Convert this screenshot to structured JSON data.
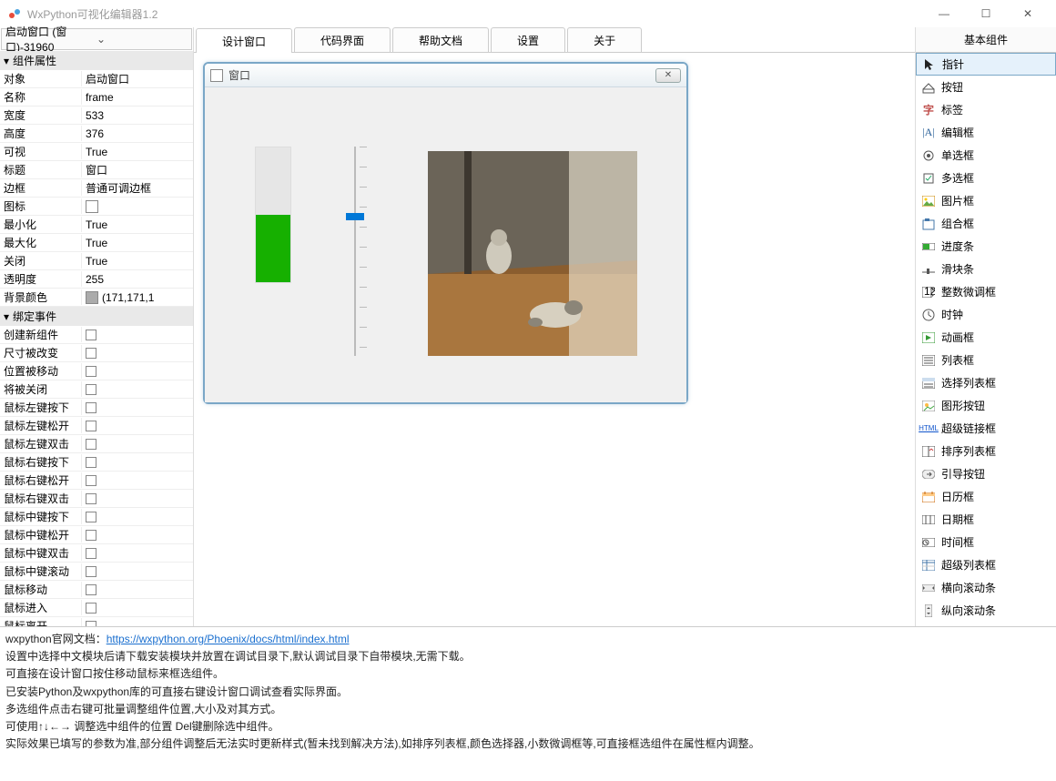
{
  "app": {
    "title": "WxPython可视化编辑器1.2"
  },
  "window_controls": {
    "min": "—",
    "max": "☐",
    "close": "✕"
  },
  "left": {
    "combo": "启动窗口  (窗口)-31960",
    "section_props": "组件属性",
    "section_events": "绑定事件",
    "props": [
      {
        "k": "对象",
        "v": "启动窗口"
      },
      {
        "k": "名称",
        "v": "frame"
      },
      {
        "k": "宽度",
        "v": "533"
      },
      {
        "k": "高度",
        "v": "376"
      },
      {
        "k": "可视",
        "v": "True"
      },
      {
        "k": "标题",
        "v": "窗口"
      },
      {
        "k": "边框",
        "v": "普通可调边框"
      },
      {
        "k": "图标",
        "v": "",
        "swatch": "#ffffff"
      },
      {
        "k": "最小化",
        "v": "True"
      },
      {
        "k": "最大化",
        "v": "True"
      },
      {
        "k": "关闭",
        "v": "True"
      },
      {
        "k": "透明度",
        "v": "255"
      },
      {
        "k": "背景颜色",
        "v": "(171,171,1",
        "swatch": "#ababab"
      }
    ],
    "events": [
      "创建新组件",
      "尺寸被改变",
      "位置被移动",
      "将被关闭",
      "鼠标左键按下",
      "鼠标左键松开",
      "鼠标左键双击",
      "鼠标右键按下",
      "鼠标右键松开",
      "鼠标右键双击",
      "鼠标中键按下",
      "鼠标中键松开",
      "鼠标中键双击",
      "鼠标中键滚动",
      "鼠标移动",
      "鼠标进入",
      "鼠标离开"
    ]
  },
  "tabs": [
    "设计窗口",
    "代码界面",
    "帮助文档",
    "设置",
    "关于"
  ],
  "sim": {
    "title": "窗口",
    "close": "✕"
  },
  "right": {
    "header": "基本组件",
    "items": [
      {
        "icon": "cursor",
        "label": "指针"
      },
      {
        "icon": "btn",
        "label": "按钮"
      },
      {
        "icon": "label",
        "label": "标签"
      },
      {
        "icon": "edit",
        "label": "编辑框"
      },
      {
        "icon": "radio",
        "label": "单选框"
      },
      {
        "icon": "check",
        "label": "多选框"
      },
      {
        "icon": "image",
        "label": "图片框"
      },
      {
        "icon": "group",
        "label": "组合框"
      },
      {
        "icon": "progress",
        "label": "进度条"
      },
      {
        "icon": "slider",
        "label": "滑块条"
      },
      {
        "icon": "spin",
        "label": "整数微调框"
      },
      {
        "icon": "clock",
        "label": "时钟"
      },
      {
        "icon": "anim",
        "label": "动画框"
      },
      {
        "icon": "list",
        "label": "列表框"
      },
      {
        "icon": "choice",
        "label": "选择列表框"
      },
      {
        "icon": "bmpbtn",
        "label": "图形按钮"
      },
      {
        "icon": "link",
        "label": "超级链接框"
      },
      {
        "icon": "sortlist",
        "label": "排序列表框"
      },
      {
        "icon": "wizard",
        "label": "引导按钮"
      },
      {
        "icon": "cal",
        "label": "日历框"
      },
      {
        "icon": "date",
        "label": "日期框"
      },
      {
        "icon": "time",
        "label": "时间框"
      },
      {
        "icon": "superlist",
        "label": "超级列表框"
      },
      {
        "icon": "hscroll",
        "label": "横向滚动条"
      },
      {
        "icon": "vscroll",
        "label": "纵向滚动条"
      }
    ]
  },
  "bottom": {
    "l1a": "wxpython官网文档：",
    "l1link": "https://wxpython.org/Phoenix/docs/html/index.html",
    "l2": "设置中选择中文模块后请下载安装模块并放置在调试目录下,默认调试目录下自带模块,无需下载。",
    "l3": "可直接在设计窗口按住移动鼠标来框选组件。",
    "l4": "已安装Python及wxpython库的可直接右键设计窗口调试查看实际界面。",
    "l5": "多选组件点击右键可批量调整组件位置,大小及对其方式。",
    "l6": "可使用↑↓←→ 调整选中组件的位置 Del键删除选中组件。",
    "l7": "实际效果已填写的参数为准,部分组件调整后无法实时更新样式(暂未找到解决方法),如排序列表框,颜色选择器,小数微调框等,可直接框选组件在属性框内调整。"
  }
}
